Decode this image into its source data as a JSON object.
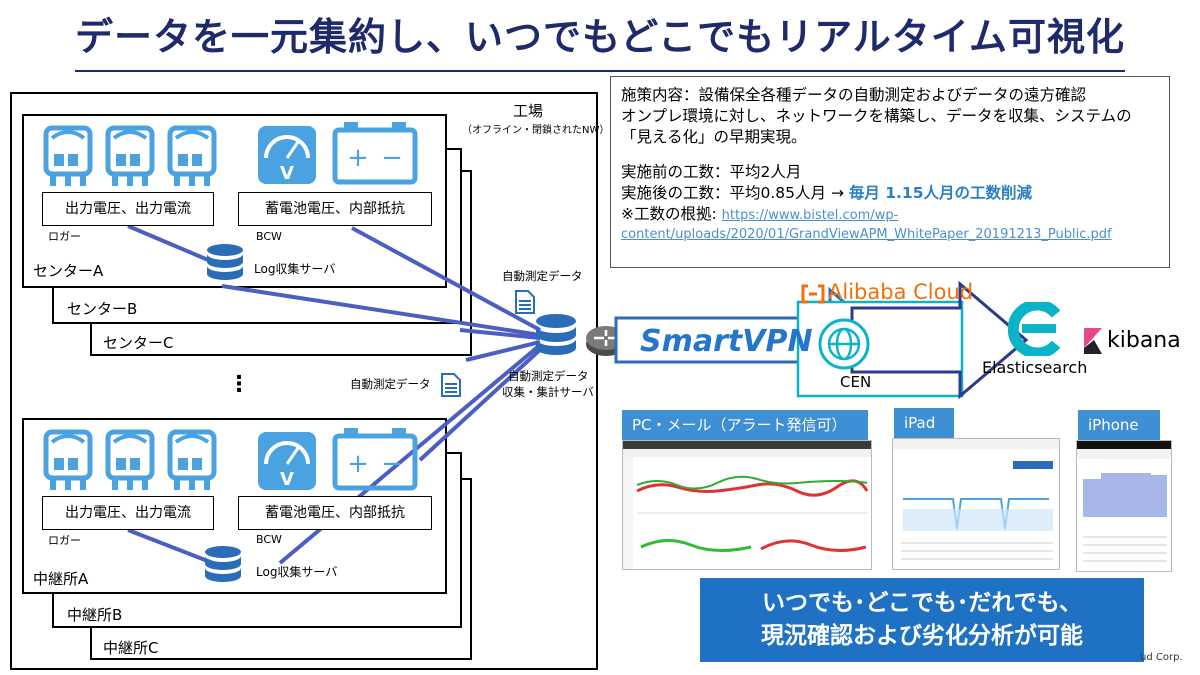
{
  "title": "データを一元集約し、いつでもどこでもリアルタイム可視化",
  "factory": {
    "label": "工場",
    "sublabel": "（オフライン・閉鎖されたNW）"
  },
  "centers": {
    "a": "センターA",
    "b": "センターB",
    "c": "センターC"
  },
  "relays": {
    "a": "中継所A",
    "b": "中継所B",
    "c": "中継所C"
  },
  "devices": {
    "logger_box": "出力電圧、出力電流",
    "logger_label": "ロガー",
    "bcw_box": "蓄電池電圧、内部抵抗",
    "bcw_label": "BCW",
    "log_server": "Log収集サーバ"
  },
  "ellipsis": "⋮",
  "auto_data_label_top": "自動測定データ",
  "auto_data_label_mid": "自動測定データ",
  "collect_server_label_1": "自動測定データ",
  "collect_server_label_2": "収集・集計サーバ",
  "info": {
    "line1": "施策内容：設備保全各種データの自動測定およびデータの遠方確認",
    "line2": "オンプレ環境に対し、ネットワークを構築し、データを収集、システムの",
    "line3": "「見える化」の早期実現。",
    "before": "実施前の工数：平均2人月",
    "after_prefix": "実施後の工数：平均0.85人月 → ",
    "after_highlight": "毎月 1.15人月の工数削減",
    "basis_label": "※工数の根拠: ",
    "basis_url_1": "https://www.bistel.com/wp-",
    "basis_url_2": "content/uploads/2020/01/GrandViewAPM_WhitePaper_20191213_Public.pdf"
  },
  "cloud": {
    "smartvpn": "SmartVPN",
    "alibaba": "Alibaba Cloud",
    "cen": "CEN",
    "elasticsearch": "Elasticsearch",
    "kibana": "kibana"
  },
  "screens": {
    "pc": "PC・メール（アラート発信可）",
    "ipad": "iPad",
    "iphone": "iPhone"
  },
  "banner": {
    "line1": "いつでも･どこでも･だれでも、",
    "line2": "現況確認および劣化分析が可能"
  },
  "copyright_fragment": "ud Corp.",
  "colors": {
    "title": "#1f2a6b",
    "accent_blue": "#3e8fd4",
    "banner": "#1f72c3",
    "link_line": "#4a5fc1",
    "alibaba": "#f0700a",
    "elastic": "#0bb3c9",
    "highlight": "#2a7fc6"
  }
}
